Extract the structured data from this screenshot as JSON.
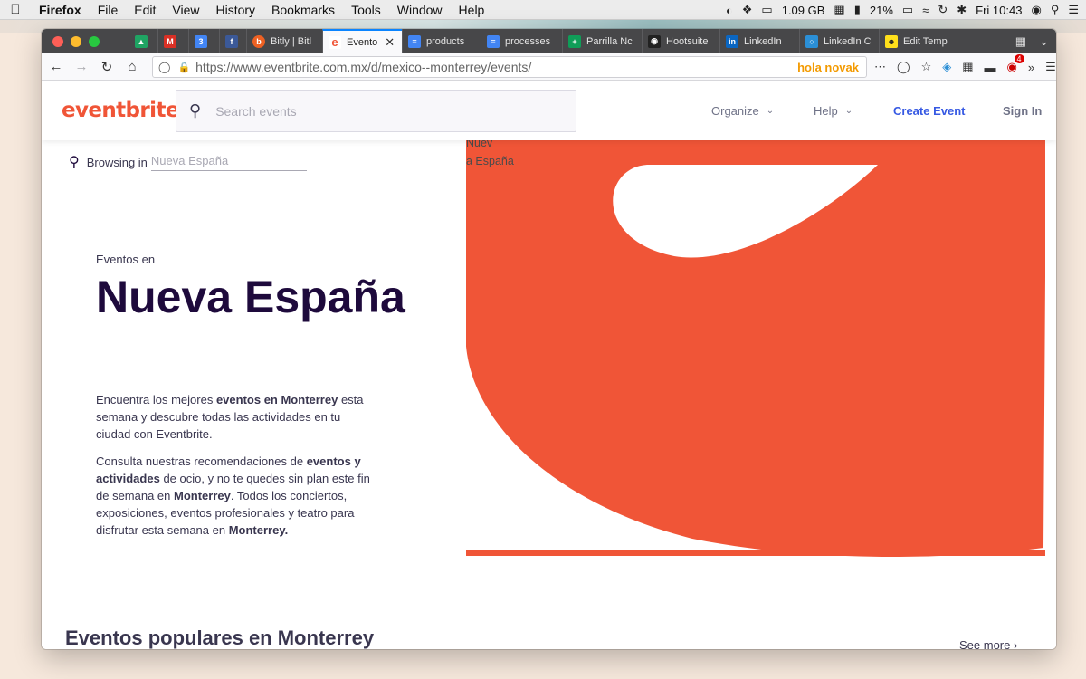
{
  "menubar": {
    "app": "Firefox",
    "items": [
      "File",
      "Edit",
      "View",
      "History",
      "Bookmarks",
      "Tools",
      "Window",
      "Help"
    ],
    "status": {
      "memory": "1.09 GB",
      "battery": "21%",
      "clock": "Fri 10:43"
    }
  },
  "browser": {
    "tabs": [
      {
        "label": "",
        "icon": "drive-icon",
        "color": "#1fa463"
      },
      {
        "label": "",
        "icon": "gmail-icon",
        "color": "#d93025"
      },
      {
        "label": "",
        "icon": "calendar-icon",
        "color": "#4285f4"
      },
      {
        "label": "",
        "icon": "facebook-icon",
        "color": "#3b5998"
      },
      {
        "label": "Bitly | Bitl",
        "icon": "bitly-icon",
        "color": "#ee6123"
      },
      {
        "label": "Evento",
        "icon": "eventbrite-icon",
        "color": "#f05537"
      },
      {
        "label": "products",
        "icon": "docs-icon",
        "color": "#4285f4"
      },
      {
        "label": "processes",
        "icon": "docs-icon",
        "color": "#4285f4"
      },
      {
        "label": "Parrilla Nc",
        "icon": "sheets-icon",
        "color": "#0f9d58"
      },
      {
        "label": "Hootsuite",
        "icon": "hootsuite-icon",
        "color": "#222222"
      },
      {
        "label": "LinkedIn",
        "icon": "linkedin-icon",
        "color": "#0a66c2"
      },
      {
        "label": "LinkedIn C",
        "icon": "linkedin-c-icon",
        "color": "#2b8fd6"
      },
      {
        "label": "Edit Temp",
        "icon": "mailchimp-icon",
        "color": "#ffe01b"
      }
    ],
    "url_host": "https://www.eventbrite.com.mx",
    "url_path": "/d/mexico--monterrey/events/",
    "hola_label": "hola novak",
    "extension_badge": "4"
  },
  "eventbrite": {
    "logo": "eventbrite",
    "search_placeholder": "Search events",
    "nav": {
      "organize": "Organize",
      "help": "Help",
      "create_event": "Create Event",
      "sign_in": "Sign In"
    },
    "browsing_label": "Browsing in",
    "browsing_location": "Nueva España",
    "hero": {
      "subtitle": "Eventos en",
      "title": "Nueva España",
      "p1": [
        {
          "text": "Encuentra los mejores ",
          "bold": false
        },
        {
          "text": "eventos en Monterrey",
          "bold": true
        },
        {
          "text": " esta semana y descubre todas las actividades en tu ciudad con Eventbrite.",
          "bold": false
        }
      ],
      "p2": [
        {
          "text": "Consulta nuestras recomendaciones de ",
          "bold": false
        },
        {
          "text": "eventos y actividades",
          "bold": true
        },
        {
          "text": " de ocio, y no te quedes sin plan este fin de semana en ",
          "bold": false
        },
        {
          "text": "Monterrey",
          "bold": true
        },
        {
          "text": ". Todos los conciertos, exposiciones, eventos profesionales y teatro para disfrutar esta semana en ",
          "bold": false
        },
        {
          "text": "Monterrey.",
          "bold": true
        }
      ],
      "art_label_1": "Nuev",
      "art_label_2": "a España",
      "brand_color": "#f05537"
    },
    "popular_title": "Eventos populares en Monterrey",
    "see_more": "See more"
  }
}
